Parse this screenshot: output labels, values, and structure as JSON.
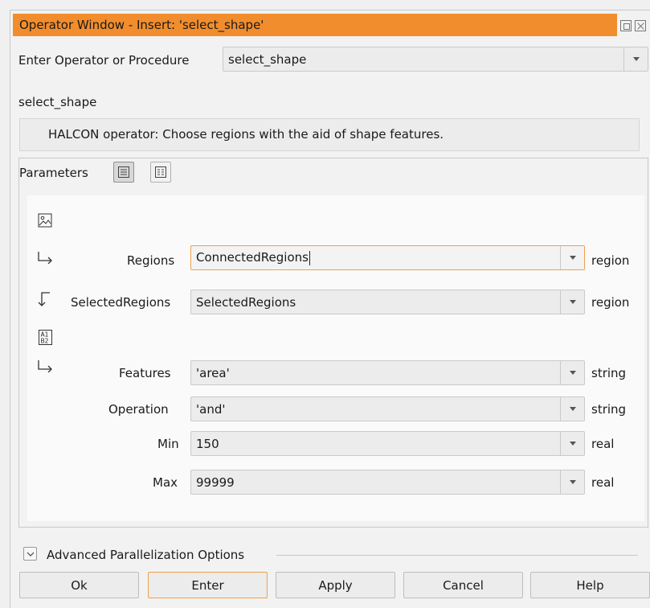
{
  "window": {
    "title": "Operator Window - Insert: 'select_shape'"
  },
  "operator": {
    "label": "Enter Operator or Procedure",
    "value": "select_shape"
  },
  "section_name": "select_shape",
  "description": "HALCON operator:  Choose regions with the aid of shape features.",
  "parameters": {
    "label": "Parameters",
    "iconic_inputs": [
      {
        "name": "Regions",
        "value": "ConnectedRegions",
        "type": "region"
      }
    ],
    "iconic_outputs": [
      {
        "name": "SelectedRegions",
        "value": "SelectedRegions",
        "type": "region"
      }
    ],
    "control_inputs": [
      {
        "name": "Features",
        "value": "'area'",
        "type": "string"
      },
      {
        "name": "Operation",
        "value": "'and'",
        "type": "string"
      },
      {
        "name": "Min",
        "value": "150",
        "type": "real"
      },
      {
        "name": "Max",
        "value": "99999",
        "type": "real"
      }
    ]
  },
  "advanced": {
    "label": "Advanced Parallelization Options"
  },
  "buttons": {
    "ok": "Ok",
    "enter": "Enter",
    "apply": "Apply",
    "cancel": "Cancel",
    "help": "Help"
  },
  "colors": {
    "title_bar": "#f18d2d",
    "focus_border": "#f0a050"
  }
}
